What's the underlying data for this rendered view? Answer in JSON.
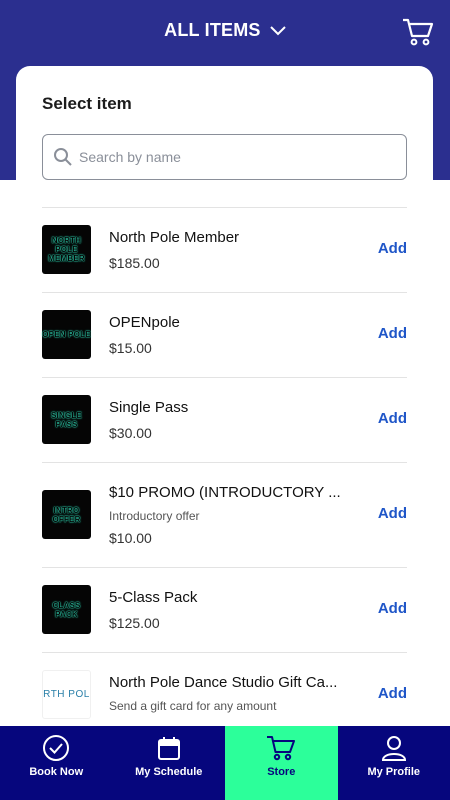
{
  "header": {
    "title": "ALL ITEMS",
    "chevron_icon": "chevron-down-icon",
    "cart_icon": "cart-icon"
  },
  "colors": {
    "brand": "#2b2f8f",
    "nav_bg": "#06067d",
    "nav_active": "#2cff9a",
    "accent": "#1f56c8"
  },
  "panel": {
    "title": "Select item",
    "search": {
      "placeholder": "Search by name",
      "value": "",
      "icon": "search-icon"
    }
  },
  "items": [
    {
      "thumb_text": "NORTH POLE MEMBER",
      "name": "North Pole Member",
      "subtitle": "",
      "price": "$185.00",
      "action": "Add"
    },
    {
      "thumb_text": "OPEN POLE",
      "name": "OPENpole",
      "subtitle": "",
      "price": "$15.00",
      "action": "Add"
    },
    {
      "thumb_text": "SINGLE PASS",
      "name": "Single Pass",
      "subtitle": "",
      "price": "$30.00",
      "action": "Add"
    },
    {
      "thumb_text": "INTRO OFFER",
      "name": "$10 PROMO (INTRODUCTORY ...",
      "subtitle": "Introductory offer",
      "price": "$10.00",
      "action": "Add"
    },
    {
      "thumb_text": "CLASS PACK",
      "name": "5-Class Pack",
      "subtitle": "",
      "price": "$125.00",
      "action": "Add"
    },
    {
      "thumb_text": "RTH POL",
      "name": "North Pole Dance Studio Gift Ca...",
      "subtitle": "Send a gift card for any amount",
      "price": "",
      "action": "Add"
    }
  ],
  "nav": [
    {
      "label": "Book Now",
      "icon": "check-circle-icon"
    },
    {
      "label": "My Schedule",
      "icon": "calendar-icon"
    },
    {
      "label": "Store",
      "icon": "cart-icon",
      "active": true
    },
    {
      "label": "My Profile",
      "icon": "user-icon"
    }
  ]
}
